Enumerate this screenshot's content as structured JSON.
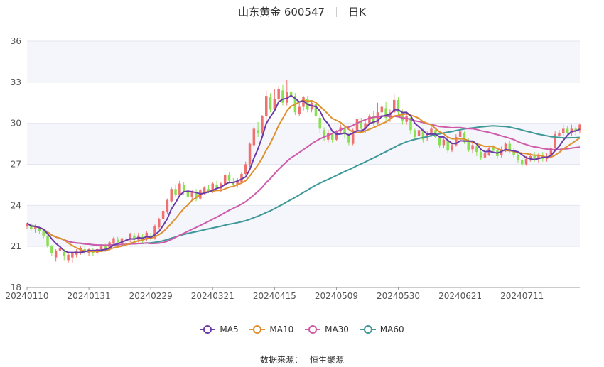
{
  "header": {
    "stock": "山东黄金 600547",
    "period": "日K"
  },
  "source": {
    "label": "数据来源：",
    "provider": "恒生聚源"
  },
  "colors": {
    "up": "#f07070",
    "down": "#88e050",
    "ma5": "#6a3aa8",
    "ma10": "#e0902e",
    "ma30": "#d05aaa",
    "ma60": "#3e9898",
    "grid": "#e2e6ee",
    "band": "#f4f6fb",
    "axis": "#555555"
  },
  "chart_data": {
    "type": "candlestick",
    "ylim": [
      18,
      36
    ],
    "y_ticks": [
      18,
      21,
      24,
      27,
      30,
      33,
      36
    ],
    "x_tick_labels": [
      "20240110",
      "20240131",
      "20240229",
      "20240321",
      "20240415",
      "20240509",
      "20240530",
      "20240621",
      "20240711"
    ],
    "x_tick_index": [
      0,
      15,
      30,
      45,
      60,
      75,
      90,
      105,
      120
    ],
    "grid": true,
    "legend_position": "bottom",
    "legend": [
      "MA5",
      "MA10",
      "MA30",
      "MA60"
    ],
    "candles": [
      [
        22.5,
        22.7,
        22.7,
        22.3
      ],
      [
        22.6,
        22.3,
        22.7,
        22.1
      ],
      [
        22.3,
        22.4,
        22.6,
        22.0
      ],
      [
        22.4,
        22.1,
        22.5,
        21.9
      ],
      [
        22.1,
        21.8,
        22.2,
        21.6
      ],
      [
        21.8,
        21.0,
        21.9,
        20.9
      ],
      [
        21.0,
        20.5,
        21.1,
        20.3
      ],
      [
        20.2,
        20.7,
        20.8,
        19.9
      ],
      [
        20.7,
        20.9,
        21.0,
        20.5
      ],
      [
        20.6,
        20.3,
        20.8,
        20.0
      ],
      [
        20.0,
        20.4,
        20.5,
        19.8
      ],
      [
        20.2,
        20.5,
        20.6,
        19.8
      ],
      [
        20.4,
        20.7,
        20.8,
        20.2
      ],
      [
        20.6,
        20.9,
        21.0,
        20.4
      ],
      [
        20.8,
        20.6,
        21.0,
        20.4
      ],
      [
        20.5,
        20.8,
        20.9,
        20.3
      ],
      [
        20.7,
        20.5,
        20.9,
        20.3
      ],
      [
        20.5,
        20.8,
        20.9,
        20.4
      ],
      [
        20.8,
        21.0,
        21.1,
        20.6
      ],
      [
        21.0,
        20.8,
        21.2,
        20.6
      ],
      [
        20.8,
        21.3,
        21.4,
        20.7
      ],
      [
        21.2,
        21.6,
        21.7,
        21.0
      ],
      [
        21.5,
        21.3,
        21.7,
        21.0
      ],
      [
        21.2,
        21.6,
        21.8,
        21.0
      ],
      [
        21.5,
        21.4,
        21.7,
        21.2
      ],
      [
        21.5,
        21.9,
        22.0,
        21.3
      ],
      [
        21.8,
        21.5,
        22.0,
        21.3
      ],
      [
        21.5,
        21.8,
        22.0,
        21.3
      ],
      [
        21.7,
        21.4,
        21.9,
        21.2
      ],
      [
        21.5,
        22.0,
        22.1,
        21.4
      ],
      [
        21.8,
        21.6,
        22.0,
        21.4
      ],
      [
        21.6,
        22.5,
        22.6,
        21.5
      ],
      [
        22.4,
        23.0,
        23.1,
        22.3
      ],
      [
        23.0,
        23.6,
        23.7,
        22.8
      ],
      [
        23.5,
        24.4,
        24.5,
        23.4
      ],
      [
        24.3,
        25.2,
        25.3,
        24.2
      ],
      [
        25.2,
        24.8,
        25.5,
        24.6
      ],
      [
        24.8,
        25.6,
        25.8,
        24.7
      ],
      [
        25.5,
        25.0,
        25.7,
        24.8
      ],
      [
        25.0,
        24.6,
        25.2,
        24.4
      ],
      [
        24.6,
        25.0,
        25.1,
        24.4
      ],
      [
        25.0,
        24.5,
        25.2,
        24.3
      ],
      [
        24.5,
        25.1,
        25.2,
        24.4
      ],
      [
        25.0,
        25.3,
        25.4,
        24.8
      ],
      [
        25.2,
        25.0,
        25.5,
        24.9
      ],
      [
        25.0,
        25.6,
        25.7,
        24.9
      ],
      [
        25.5,
        25.2,
        25.8,
        25.1
      ],
      [
        25.2,
        25.6,
        25.7,
        25.0
      ],
      [
        25.5,
        26.2,
        26.3,
        25.4
      ],
      [
        26.2,
        25.8,
        26.4,
        25.6
      ],
      [
        25.7,
        25.5,
        26.0,
        25.3
      ],
      [
        25.5,
        25.8,
        26.0,
        25.3
      ],
      [
        25.7,
        26.3,
        26.4,
        25.6
      ],
      [
        26.3,
        27.0,
        27.2,
        26.2
      ],
      [
        27.0,
        28.5,
        28.6,
        26.8
      ],
      [
        28.4,
        29.6,
        29.8,
        28.2
      ],
      [
        29.5,
        29.3,
        30.1,
        29.0
      ],
      [
        29.3,
        30.5,
        30.6,
        29.2
      ],
      [
        30.5,
        32.0,
        32.4,
        30.2
      ],
      [
        31.9,
        31.0,
        32.2,
        30.8
      ],
      [
        31.0,
        31.8,
        32.5,
        30.9
      ],
      [
        31.8,
        32.5,
        32.7,
        31.5
      ],
      [
        32.4,
        31.5,
        32.8,
        31.3
      ],
      [
        31.5,
        32.3,
        33.2,
        31.3
      ],
      [
        32.3,
        32.0,
        32.5,
        31.7
      ],
      [
        32.0,
        30.8,
        32.2,
        30.6
      ],
      [
        30.7,
        31.2,
        31.5,
        30.5
      ],
      [
        31.2,
        31.9,
        32.0,
        30.9
      ],
      [
        31.8,
        31.0,
        32.0,
        30.8
      ],
      [
        31.0,
        31.5,
        31.6,
        30.8
      ],
      [
        31.4,
        30.5,
        31.6,
        30.2
      ],
      [
        30.4,
        29.6,
        30.6,
        29.3
      ],
      [
        29.5,
        28.9,
        29.7,
        28.7
      ],
      [
        28.8,
        29.3,
        29.5,
        28.6
      ],
      [
        29.2,
        28.8,
        29.3,
        28.6
      ],
      [
        28.8,
        29.4,
        29.5,
        28.7
      ],
      [
        29.4,
        29.7,
        29.9,
        29.3
      ],
      [
        29.6,
        29.2,
        29.8,
        28.9
      ],
      [
        29.2,
        28.6,
        29.3,
        28.4
      ],
      [
        28.5,
        29.5,
        29.6,
        28.4
      ],
      [
        29.5,
        30.3,
        30.4,
        29.4
      ],
      [
        30.2,
        29.6,
        30.4,
        29.5
      ],
      [
        29.6,
        30.0,
        30.3,
        29.3
      ],
      [
        30.0,
        30.5,
        30.7,
        29.9
      ],
      [
        30.5,
        30.0,
        30.9,
        29.8
      ],
      [
        30.0,
        30.8,
        31.5,
        29.9
      ],
      [
        30.8,
        31.2,
        31.3,
        30.6
      ],
      [
        31.1,
        30.4,
        31.6,
        30.2
      ],
      [
        30.4,
        30.8,
        31.0,
        30.1
      ],
      [
        30.8,
        31.7,
        32.1,
        30.7
      ],
      [
        31.7,
        30.8,
        31.9,
        30.5
      ],
      [
        30.8,
        30.2,
        31.0,
        29.9
      ],
      [
        30.1,
        30.5,
        30.7,
        29.9
      ],
      [
        30.4,
        29.5,
        30.6,
        29.2
      ],
      [
        29.5,
        29.0,
        29.6,
        28.8
      ],
      [
        29.1,
        29.5,
        29.6,
        28.8
      ],
      [
        29.4,
        28.8,
        29.6,
        28.6
      ],
      [
        28.9,
        29.2,
        29.4,
        28.7
      ],
      [
        29.1,
        29.6,
        29.8,
        29.0
      ],
      [
        29.5,
        29.0,
        29.7,
        28.9
      ],
      [
        28.9,
        28.4,
        29.1,
        28.2
      ],
      [
        28.4,
        28.8,
        29.0,
        28.2
      ],
      [
        28.7,
        28.0,
        28.9,
        27.8
      ],
      [
        28.0,
        28.4,
        28.6,
        27.9
      ],
      [
        28.4,
        29.0,
        29.2,
        28.3
      ],
      [
        29.0,
        29.4,
        29.6,
        28.9
      ],
      [
        29.3,
        28.7,
        29.4,
        28.5
      ],
      [
        28.7,
        28.0,
        28.9,
        27.9
      ],
      [
        28.1,
        28.4,
        28.6,
        27.8
      ],
      [
        28.3,
        27.9,
        28.5,
        27.6
      ],
      [
        27.9,
        27.5,
        28.1,
        27.3
      ],
      [
        27.5,
        27.8,
        28.0,
        27.3
      ],
      [
        27.7,
        28.2,
        28.3,
        27.6
      ],
      [
        28.2,
        28.0,
        28.4,
        27.8
      ],
      [
        28.0,
        27.6,
        28.2,
        27.4
      ],
      [
        27.7,
        28.1,
        28.3,
        27.5
      ],
      [
        28.1,
        28.5,
        28.6,
        27.9
      ],
      [
        28.5,
        28.0,
        28.7,
        27.8
      ],
      [
        28.0,
        27.7,
        28.2,
        27.5
      ],
      [
        27.7,
        27.3,
        27.9,
        27.1
      ],
      [
        27.3,
        27.0,
        27.5,
        26.8
      ],
      [
        27.0,
        27.4,
        27.6,
        26.9
      ],
      [
        27.4,
        27.6,
        27.8,
        27.2
      ],
      [
        27.6,
        27.4,
        27.9,
        27.2
      ],
      [
        27.4,
        27.7,
        27.8,
        27.1
      ],
      [
        27.7,
        27.4,
        27.9,
        27.2
      ],
      [
        27.4,
        27.5,
        27.8,
        27.2
      ],
      [
        27.6,
        28.2,
        28.4,
        27.4
      ],
      [
        28.2,
        29.2,
        29.4,
        28.0
      ],
      [
        29.1,
        29.3,
        29.5,
        28.9
      ],
      [
        29.3,
        29.6,
        29.9,
        29.1
      ],
      [
        29.6,
        29.3,
        29.8,
        29.2
      ],
      [
        29.3,
        29.6,
        29.9,
        29.1
      ],
      [
        29.6,
        29.4,
        29.8,
        29.1
      ],
      [
        29.5,
        29.9,
        30.0,
        29.3
      ]
    ]
  }
}
